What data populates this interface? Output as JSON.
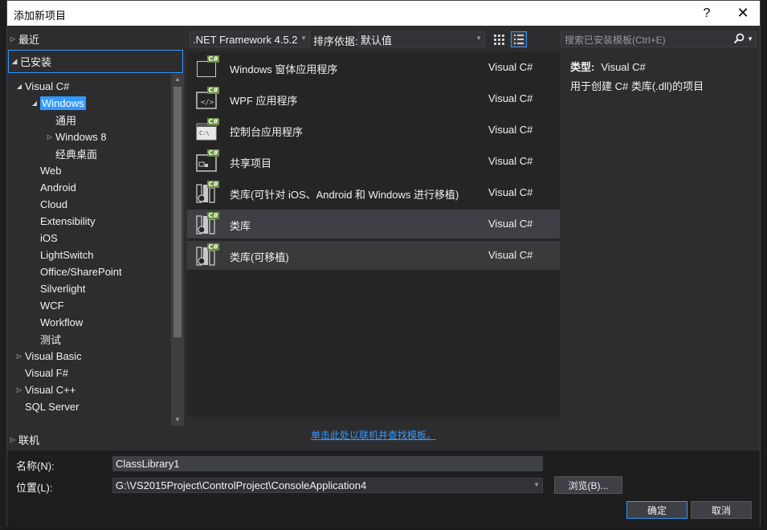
{
  "window": {
    "title": "添加新项目",
    "help_glyph": "?",
    "close_glyph": "✕"
  },
  "left_panel": {
    "recent": "最近",
    "installed": "已安装",
    "online": "联机",
    "tree": [
      {
        "label": "Visual C#",
        "expander": "open",
        "level": 0
      },
      {
        "label": "Windows",
        "expander": "open",
        "level": 1,
        "selected": true
      },
      {
        "label": "通用",
        "expander": "none",
        "level": 2
      },
      {
        "label": "Windows 8",
        "expander": "closed",
        "level": 2
      },
      {
        "label": "经典桌面",
        "expander": "none",
        "level": 2
      },
      {
        "label": "Web",
        "expander": "none",
        "level": 1
      },
      {
        "label": "Android",
        "expander": "none",
        "level": 1
      },
      {
        "label": "Cloud",
        "expander": "none",
        "level": 1
      },
      {
        "label": "Extensibility",
        "expander": "none",
        "level": 1
      },
      {
        "label": "iOS",
        "expander": "none",
        "level": 1
      },
      {
        "label": "LightSwitch",
        "expander": "none",
        "level": 1
      },
      {
        "label": "Office/SharePoint",
        "expander": "none",
        "level": 1
      },
      {
        "label": "Silverlight",
        "expander": "none",
        "level": 1
      },
      {
        "label": "WCF",
        "expander": "none",
        "level": 1
      },
      {
        "label": "Workflow",
        "expander": "none",
        "level": 1
      },
      {
        "label": "测试",
        "expander": "none",
        "level": 1
      },
      {
        "label": "Visual Basic",
        "expander": "closed",
        "level": 0
      },
      {
        "label": "Visual F#",
        "expander": "none",
        "level": 0
      },
      {
        "label": "Visual C++",
        "expander": "closed",
        "level": 0
      },
      {
        "label": "SQL Server",
        "expander": "none",
        "level": 0
      }
    ]
  },
  "toolbar": {
    "framework": ".NET Framework 4.5.2",
    "sort_label": "排序依据:",
    "sort_value": "默认值",
    "search_placeholder": "搜索已安装模板(Ctrl+E)"
  },
  "templates": [
    {
      "name": "Windows 窗体应用程序",
      "lang": "Visual C#",
      "icon": "windows-forms-icon",
      "state": "normal"
    },
    {
      "name": "WPF 应用程序",
      "lang": "Visual C#",
      "icon": "wpf-app-icon",
      "state": "normal"
    },
    {
      "name": "控制台应用程序",
      "lang": "Visual C#",
      "icon": "console-app-icon",
      "state": "normal"
    },
    {
      "name": "共享项目",
      "lang": "Visual C#",
      "icon": "shared-project-icon",
      "state": "normal"
    },
    {
      "name": "类库(可针对 iOS、Android 和 Windows 进行移植)",
      "lang": "Visual C#",
      "icon": "class-library-icon",
      "state": "normal"
    },
    {
      "name": "类库",
      "lang": "Visual C#",
      "icon": "class-library-icon",
      "state": "selected"
    },
    {
      "name": "类库(可移植)",
      "lang": "Visual C#",
      "icon": "class-library-icon",
      "state": "hover"
    }
  ],
  "badge_text": "C#",
  "online_link": "单击此处以联机并查找模板。",
  "description": {
    "type_label": "类型:",
    "type_value": "Visual C#",
    "text": "用于创建 C# 类库(.dll)的项目"
  },
  "form": {
    "name_label": "名称(N):",
    "name_value": "ClassLibrary1",
    "location_label": "位置(L):",
    "location_value": "G:\\VS2015Project\\ControlProject\\ConsoleApplication4",
    "browse": "浏览(B)...",
    "ok": "确定",
    "cancel": "取消"
  },
  "colors": {
    "accent": "#3399ff",
    "dialog_bg": "#2d2d30",
    "list_bg": "#252526",
    "cs_badge": "#6a8f3f"
  }
}
